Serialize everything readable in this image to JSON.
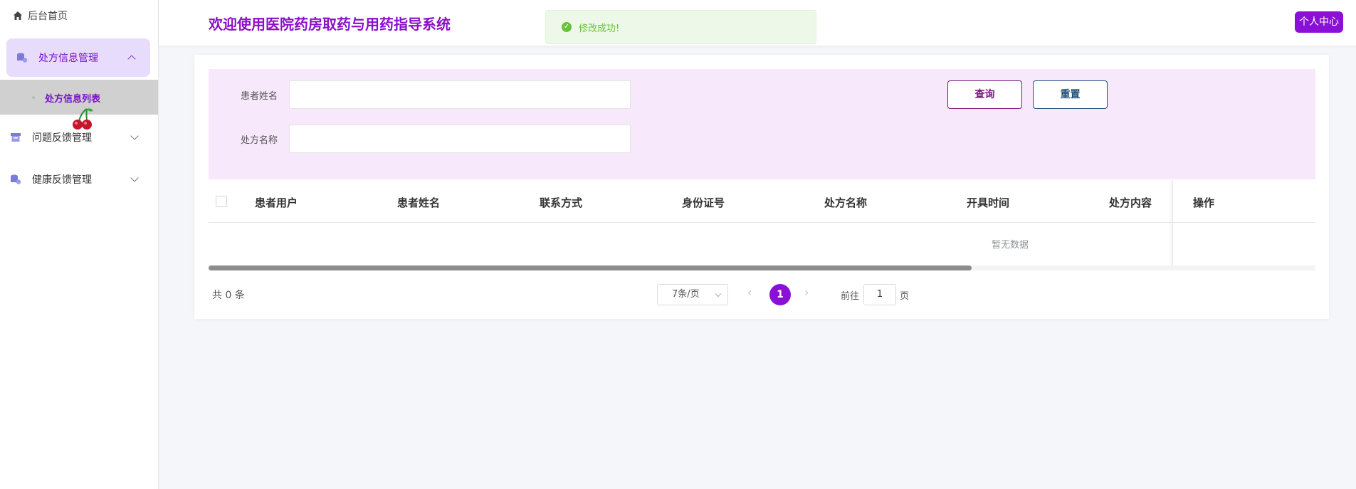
{
  "sidebar": {
    "home_label": "后台首页",
    "menus": [
      {
        "label": "处方信息管理"
      },
      {
        "label": "问题反馈管理"
      },
      {
        "label": "健康反馈管理"
      }
    ],
    "active_sub_label": "处方信息列表"
  },
  "header": {
    "title": "欢迎使用医院药房取药与用药指导系统",
    "user_button": "个人中心"
  },
  "toast": {
    "message": "修改成功!"
  },
  "search": {
    "fields": [
      {
        "label": "患者姓名",
        "value": ""
      },
      {
        "label": "处方名称",
        "value": ""
      }
    ],
    "query_button": "查询",
    "reset_button": "重置"
  },
  "table": {
    "columns": [
      "患者用户",
      "患者姓名",
      "联系方式",
      "身份证号",
      "处方名称",
      "开具时间",
      "处方内容",
      "操作"
    ],
    "empty_text": "暂无数据"
  },
  "pagination": {
    "total_text": "共 0 条",
    "page_size": "7条/页",
    "current_page": "1",
    "goto_prefix": "前往",
    "goto_value": "1",
    "goto_suffix": "页"
  },
  "colors": {
    "accent": "#8a10d8",
    "menu_active_bg": "#e7dcfb",
    "search_bg": "#f7e8fb",
    "success": "#67c23a"
  }
}
